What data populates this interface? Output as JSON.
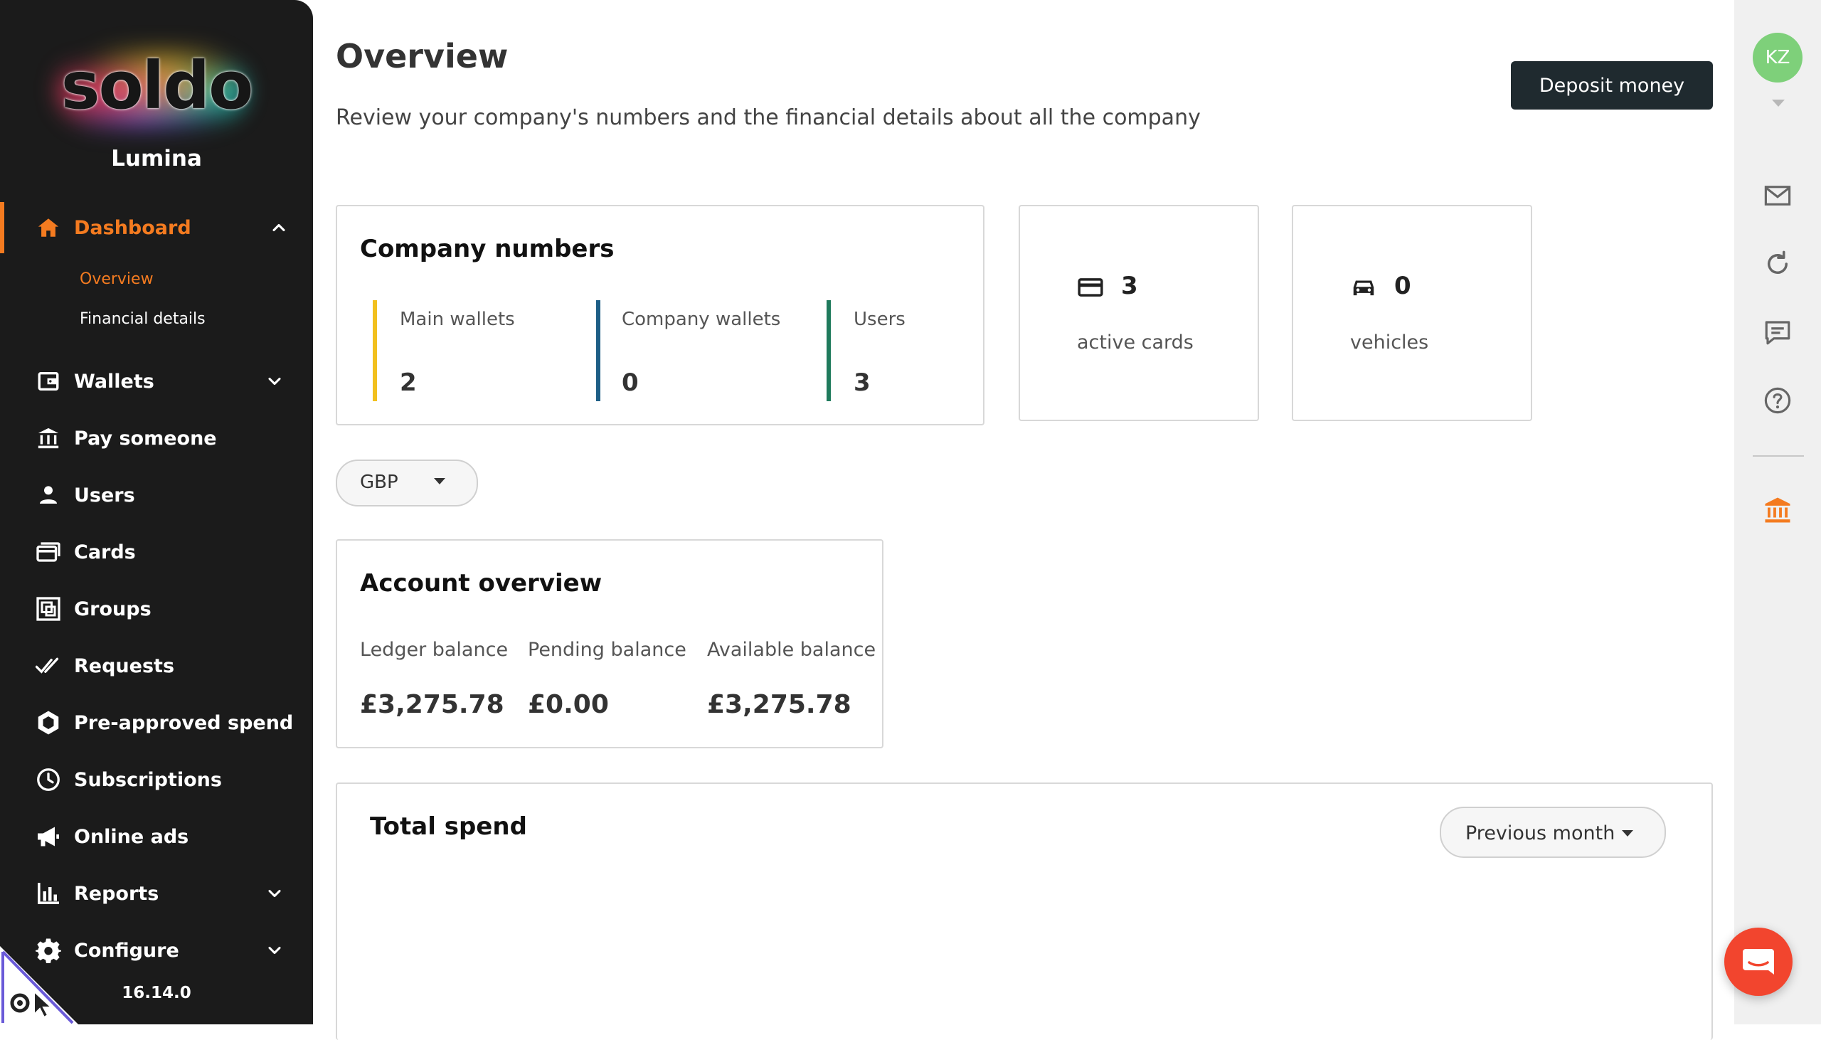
{
  "brand": {
    "logo_text": "soldo",
    "company": "Lumina",
    "version": "16.14.0"
  },
  "nav": {
    "dashboard": "Dashboard",
    "sub_overview": "Overview",
    "sub_financial": "Financial details",
    "wallets": "Wallets",
    "pay": "Pay someone",
    "users": "Users",
    "cards": "Cards",
    "groups": "Groups",
    "requests": "Requests",
    "preapproved": "Pre-approved spend",
    "subscriptions": "Subscriptions",
    "online_ads": "Online ads",
    "reports": "Reports",
    "configure": "Configure"
  },
  "header": {
    "title": "Overview",
    "subtitle": "Review your company's numbers and the financial details about all the company",
    "deposit_label": "Deposit money"
  },
  "company_numbers": {
    "title": "Company numbers",
    "metrics": [
      {
        "label": "Main wallets",
        "value": "2",
        "color": "#f2c01e"
      },
      {
        "label": "Company wallets",
        "value": "0",
        "color": "#1d5e86"
      },
      {
        "label": "Users",
        "value": "3",
        "color": "#1f7a5c"
      }
    ]
  },
  "stats": {
    "cards": {
      "value": "3",
      "label": "active cards",
      "icon": "credit-card-icon"
    },
    "vehicles": {
      "value": "0",
      "label": "vehicles",
      "icon": "car-icon"
    }
  },
  "currency": {
    "selected": "GBP"
  },
  "account_overview": {
    "title": "Account overview",
    "columns": [
      {
        "label": "Ledger balance",
        "value": "£3,275.78"
      },
      {
        "label": "Pending balance",
        "value": "£0.00"
      },
      {
        "label": "Available balance",
        "value": "£3,275.78"
      }
    ]
  },
  "total_spend": {
    "title": "Total spend",
    "period": "Previous month"
  },
  "user": {
    "initials": "KZ"
  },
  "colors": {
    "accent": "#f47b20",
    "sidebar_bg": "#1b1b1b",
    "deposit_bg": "#1f2a2f",
    "chat_fab": "#f2452e"
  }
}
